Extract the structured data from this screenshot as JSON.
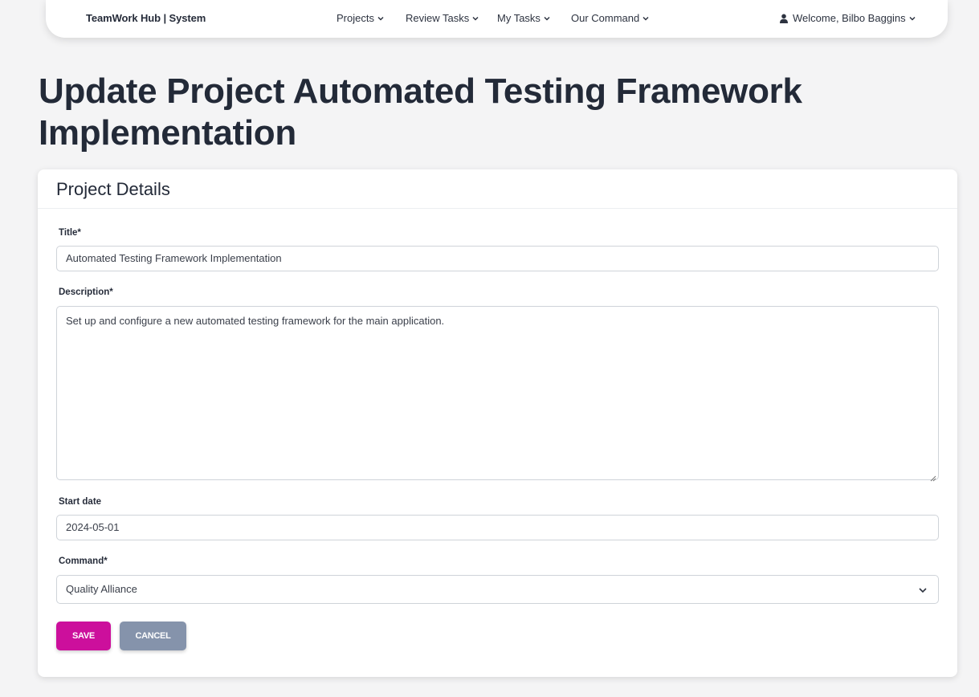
{
  "navbar": {
    "brand": "TeamWork Hub | System",
    "items": [
      {
        "label": "Projects"
      },
      {
        "label": "Review Tasks"
      },
      {
        "label": "My Tasks"
      },
      {
        "label": "Our Command"
      }
    ],
    "user_label": "Welcome, Bilbo Baggins"
  },
  "page": {
    "title": "Update Project Automated Testing Framework Implementation"
  },
  "card": {
    "title": "Project Details",
    "fields": {
      "title_label": "Title*",
      "title_value": "Automated Testing Framework Implementation",
      "description_label": "Description*",
      "description_value": "Set up and configure a new automated testing framework for the main application.",
      "start_date_label": "Start date",
      "start_date_value": "2024-05-01",
      "command_label": "Command*",
      "command_value": "Quality Alliance"
    },
    "buttons": {
      "save": "SAVE",
      "cancel": "CANCEL"
    }
  },
  "colors": {
    "save": "#cc0f9c",
    "cancel": "#8593ab",
    "background": "#f4f4f5"
  }
}
